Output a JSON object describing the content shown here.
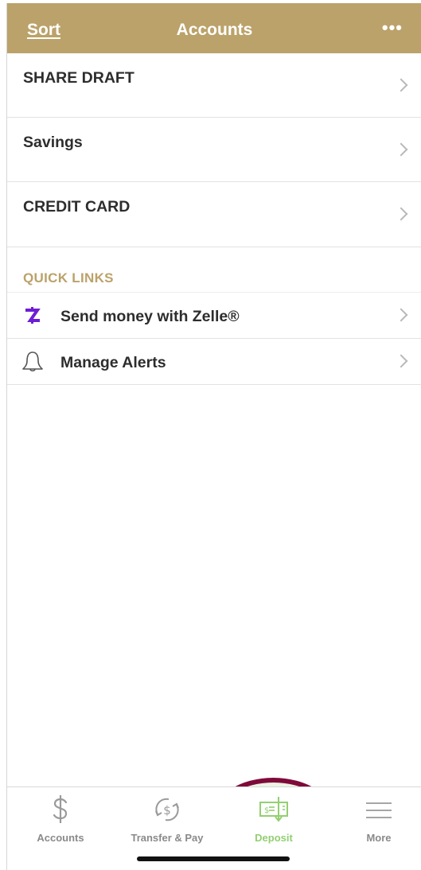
{
  "header": {
    "sort_label": "Sort",
    "title": "Accounts",
    "more_label": "•••"
  },
  "accounts": [
    {
      "name": "SHARE DRAFT"
    },
    {
      "name": "Savings"
    },
    {
      "name": "CREDIT CARD"
    }
  ],
  "quick_links": {
    "title": "QUICK LINKS",
    "items": [
      {
        "label": "Send money with Zelle®",
        "icon": "zelle-icon"
      },
      {
        "label": "Manage Alerts",
        "icon": "bell-icon"
      }
    ]
  },
  "tabbar": {
    "tabs": [
      {
        "label": "Accounts",
        "icon": "dollar-icon"
      },
      {
        "label": "Transfer & Pay",
        "icon": "transfer-icon"
      },
      {
        "label": "Deposit",
        "icon": "check-deposit-icon",
        "active": true
      },
      {
        "label": "More",
        "icon": "menu-icon"
      }
    ]
  },
  "colors": {
    "header_bg": "#bba26a",
    "accent_gold": "#bba26a",
    "active_tab": "#93cf71",
    "highlight_ring": "#7f0a3a",
    "zelle_purple": "#6d1ed4"
  }
}
